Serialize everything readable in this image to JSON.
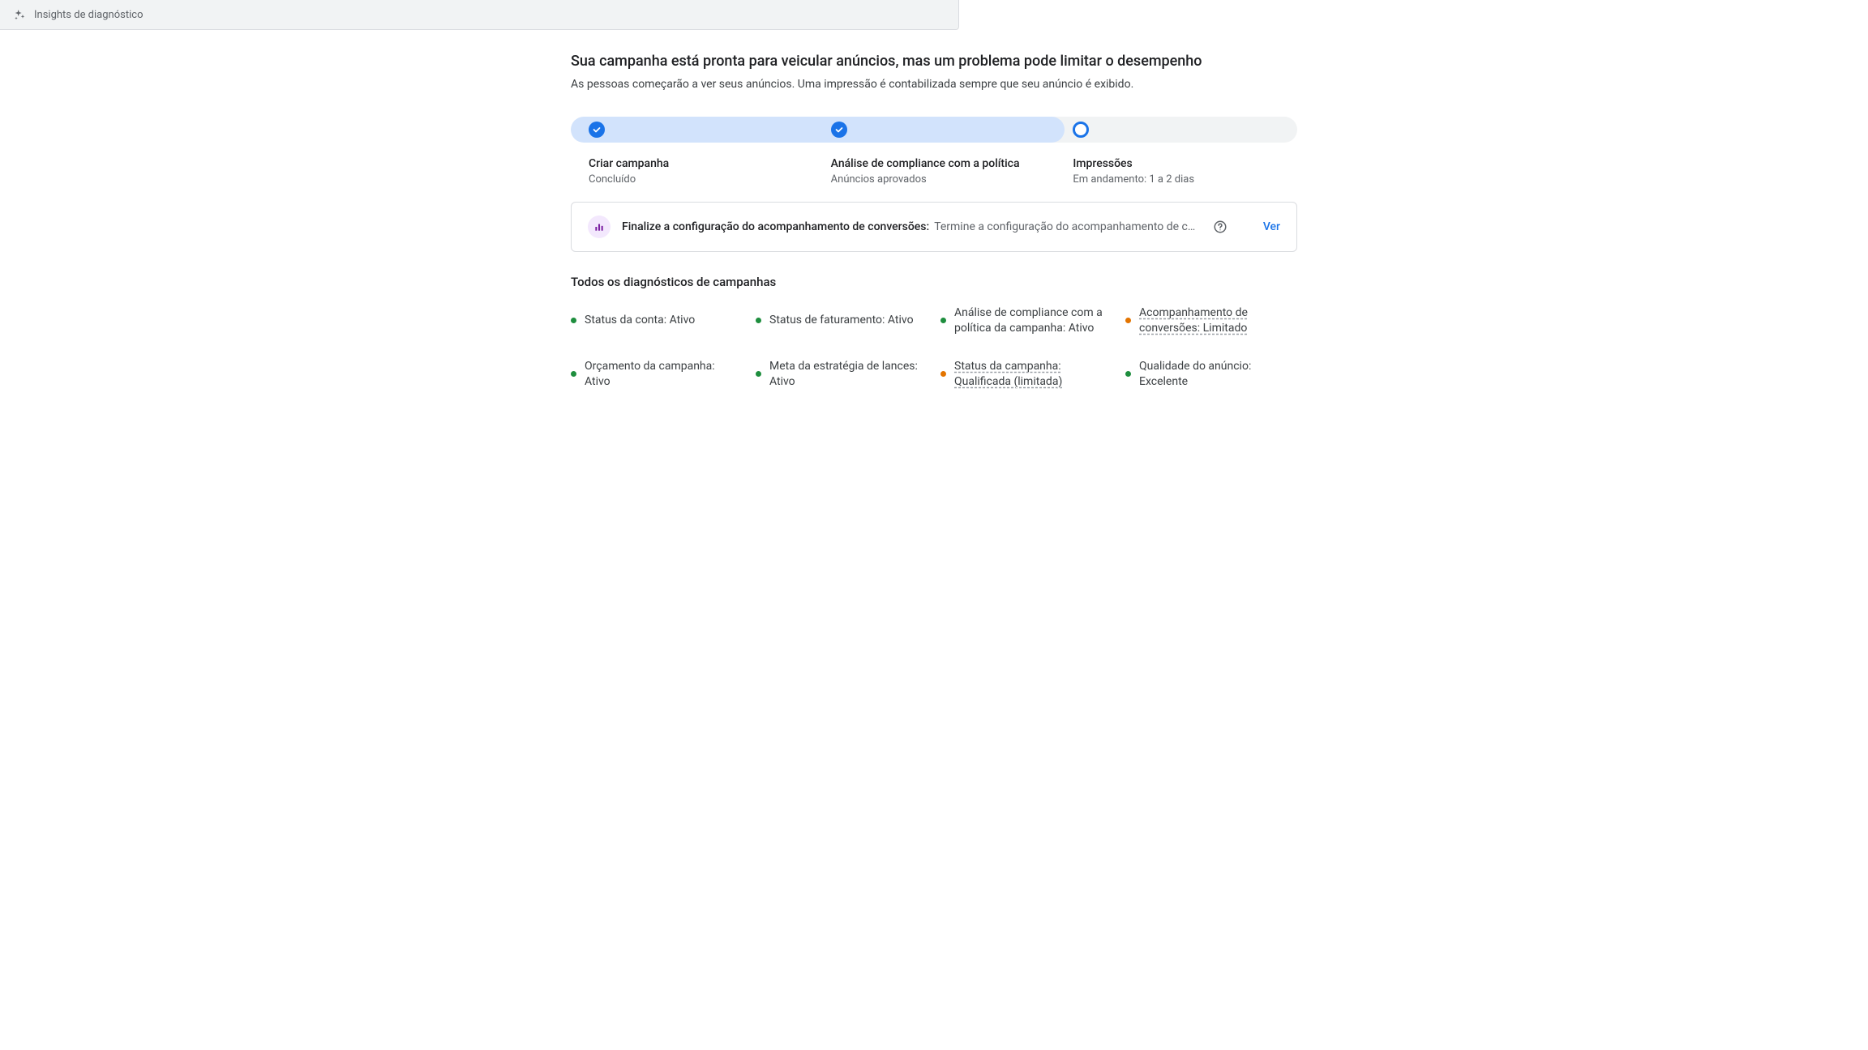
{
  "header": {
    "title": "Insights de diagnóstico"
  },
  "main": {
    "heading": "Sua campanha está pronta para veicular anúncios, mas um problema pode limitar o desempenho",
    "subheading": "As pessoas começarão a ver seus anúncios. Uma impressão é contabilizada sempre que seu anúncio é exibido."
  },
  "progress": {
    "fill_percent": 68,
    "steps": [
      {
        "state": "done",
        "title": "Criar campanha",
        "subtitle": "Concluído"
      },
      {
        "state": "done",
        "title": "Análise de compliance com a política",
        "subtitle": "Anúncios aprovados"
      },
      {
        "state": "pending",
        "title": "Impressões",
        "subtitle": "Em andamento: 1 a 2 dias"
      }
    ]
  },
  "alert": {
    "strong": "Finalize a configuração do acompanhamento de conversões:",
    "desc": "Termine a configuração do acompanhamento de conver…",
    "action": "Ver"
  },
  "diagnostics": {
    "heading": "Todos os diagnósticos de campanhas",
    "items": [
      {
        "status": "green",
        "text": "Status da conta: Ativo",
        "underline": false
      },
      {
        "status": "green",
        "text": "Status de faturamento: Ativo",
        "underline": false
      },
      {
        "status": "green",
        "text": "Análise de compliance com a política da campanha: Ativo",
        "underline": false
      },
      {
        "status": "orange",
        "text": "Acompanhamento de conversões: Limitado",
        "underline": true
      },
      {
        "status": "green",
        "text": "Orçamento da campanha: Ativo",
        "underline": false
      },
      {
        "status": "green",
        "text": "Meta da estratégia de lances: Ativo",
        "underline": false
      },
      {
        "status": "orange",
        "text": "Status da campanha: Qualificada (limitada)",
        "underline": true
      },
      {
        "status": "green",
        "text": "Qualidade do anúncio: Excelente",
        "underline": false
      }
    ]
  }
}
